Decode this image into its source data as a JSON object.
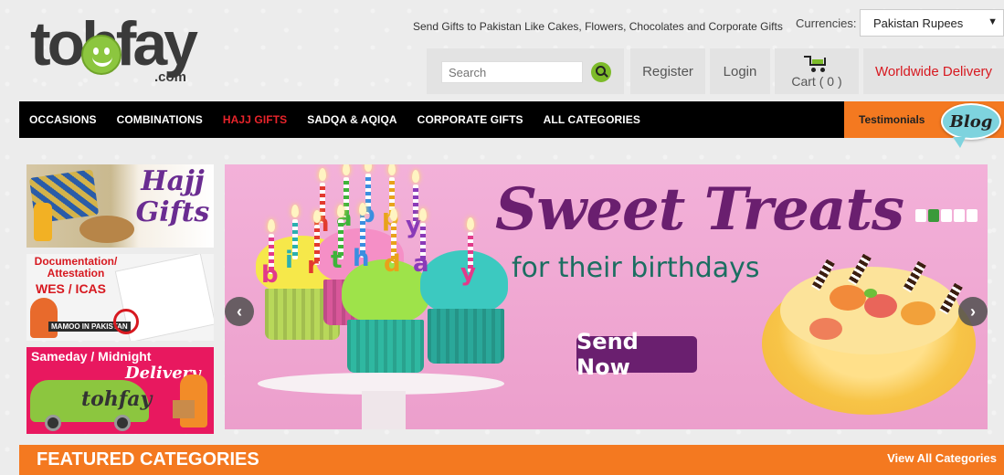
{
  "brand": {
    "logo_main": "tohfay",
    "logo_domain": ".com"
  },
  "header": {
    "tagline": "Send Gifts to Pakistan Like Cakes, Flowers, Chocolates and Corporate Gifts",
    "currency_label": "Currencies:",
    "currency_selected": "Pakistan Rupees",
    "search_placeholder": "Search",
    "register": "Register",
    "login": "Login",
    "cart": "Cart ( 0 )",
    "worldwide": "Worldwide Delivery"
  },
  "nav": {
    "items": [
      {
        "label": "OCCASIONS"
      },
      {
        "label": "COMBINATIONS"
      },
      {
        "label": "HAJJ GIFTS"
      },
      {
        "label": "SADQA & AQIQA"
      },
      {
        "label": "CORPORATE GIFTS"
      },
      {
        "label": "ALL CATEGORIES"
      }
    ],
    "testimonials": "Testimonials",
    "blog": "Blog"
  },
  "promos": {
    "hajj": {
      "title": "Hajj Gifts"
    },
    "doc": {
      "title": "Documentation/ Attestation",
      "sub": "WES / ICAS",
      "tag": "MAMOO IN PAKISTAN"
    },
    "same": {
      "title": "Sameday / Midnight",
      "sub": "Delivery",
      "van_brand": "tohfay"
    }
  },
  "slider": {
    "title": "Sweet Treats",
    "subtitle": "for their birthdays",
    "button": "Send Now",
    "candle_letters": [
      "h",
      "a",
      "p",
      "p",
      "y",
      "b",
      "i",
      "r",
      "t",
      "h",
      "d",
      "a",
      "y"
    ],
    "slide_count": 5,
    "active_slide": 2
  },
  "featured": {
    "title": "FEATURED CATEGORIES",
    "view_all": "View All Categories"
  },
  "colors": {
    "accent_orange": "#f47920",
    "nav_black": "#000000",
    "hajj_red": "#e8242b",
    "slide_purple": "#6a1f6f",
    "brand_green": "#8cc63f"
  }
}
